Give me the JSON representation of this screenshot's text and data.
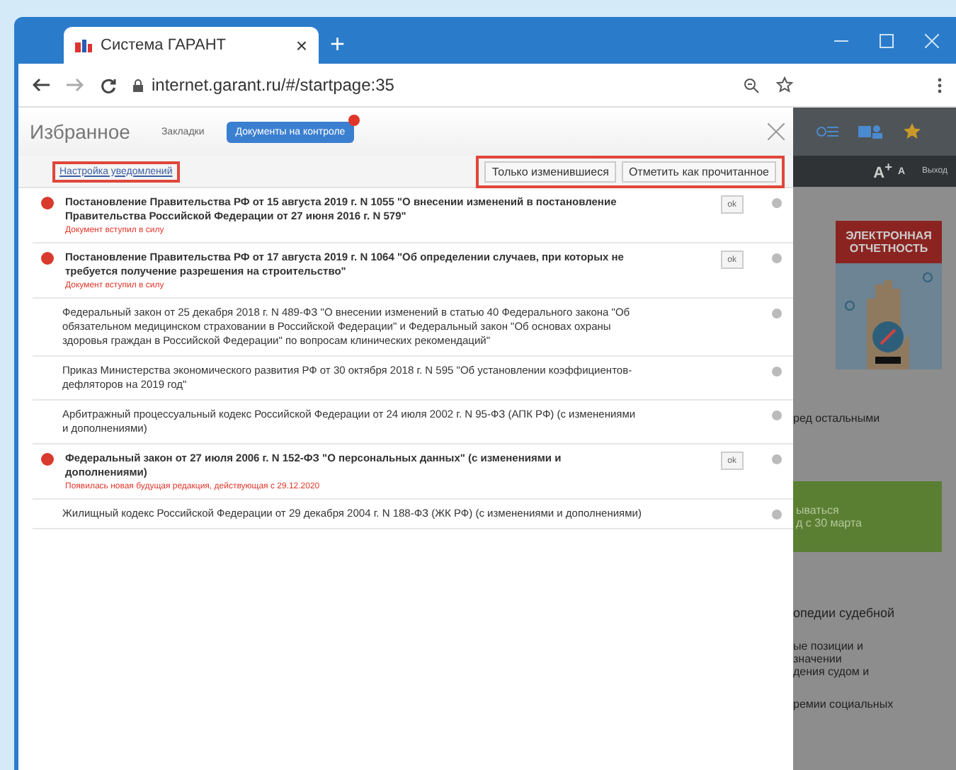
{
  "browser": {
    "tab": {
      "title": "Система ГАРАНТ",
      "close": "×"
    },
    "new_tab": "+",
    "url": "internet.garant.ru/#/startpage:35"
  },
  "panel": {
    "title": "Избранное",
    "tabs": [
      {
        "label": "Закладки",
        "selected": false,
        "badge": false
      },
      {
        "label": "Документы на контроле",
        "selected": true,
        "badge": true
      }
    ],
    "settings_link": "Настройка уведомлений",
    "filter_buttons": [
      "Только изменившиеся",
      "Отметить как прочитанное"
    ],
    "documents": [
      {
        "title": "Постановление Правительства РФ от 15 августа 2019 г. N 1055 \"О внесении изменений в постановление Правительства Российской Федерации от 27 июня 2016 г. N 579\"",
        "changed": true,
        "status": "Документ вступил в силу",
        "ok": "ok"
      },
      {
        "title": "Постановление Правительства РФ от 17 августа 2019 г. N 1064 \"Об определении случаев, при которых не требуется получение разрешения на строительство\"",
        "changed": true,
        "status": "Документ вступил в силу",
        "ok": "ok"
      },
      {
        "title": "Федеральный закон от 25 декабря 2018 г. N 489-ФЗ \"О внесении изменений в статью 40 Федерального закона \"Об обязательном медицинском страховании в Российской Федерации\" и Федеральный закон \"Об основах охраны здоровья граждан в Российской Федерации\" по вопросам клинических рекомендаций\"",
        "changed": false
      },
      {
        "title": "Приказ Министерства экономического развития РФ от 30 октября 2018 г. N 595 \"Об установлении коэффициентов-дефляторов на 2019 год\"",
        "changed": false
      },
      {
        "title": "Арбитражный процессуальный кодекс Российской Федерации от 24 июля 2002 г. N 95-ФЗ (АПК РФ) (с изменениями и дополнениями)",
        "changed": false
      },
      {
        "title": "Федеральный закон от 27 июля 2006 г. N 152-ФЗ \"О персональных данных\" (с изменениями и дополнениями)",
        "changed": true,
        "status": "Появилась новая будущая редакция, действующая с 29.12.2020",
        "ok": "ok"
      },
      {
        "title": "Жилищный кодекс Российской Федерации от 29 декабря 2004 г. N 188-ФЗ (ЖК РФ) (с изменениями и дополнениями)",
        "changed": false
      }
    ]
  },
  "background_page": {
    "font_buttons": [
      "A$^{+}$",
      "A"
    ],
    "exit": "Выход",
    "banner": "ЭЛЕКТРОННАЯ ОТЧЕТНОСТЬ",
    "text_1": "ред остальными",
    "promo": [
      "ываться",
      "д с 30 марта"
    ],
    "heading": "опедии судебной",
    "text_2": [
      "ые позиции и",
      "значении",
      "дения судом и"
    ],
    "text_3": "ремии социальных"
  }
}
